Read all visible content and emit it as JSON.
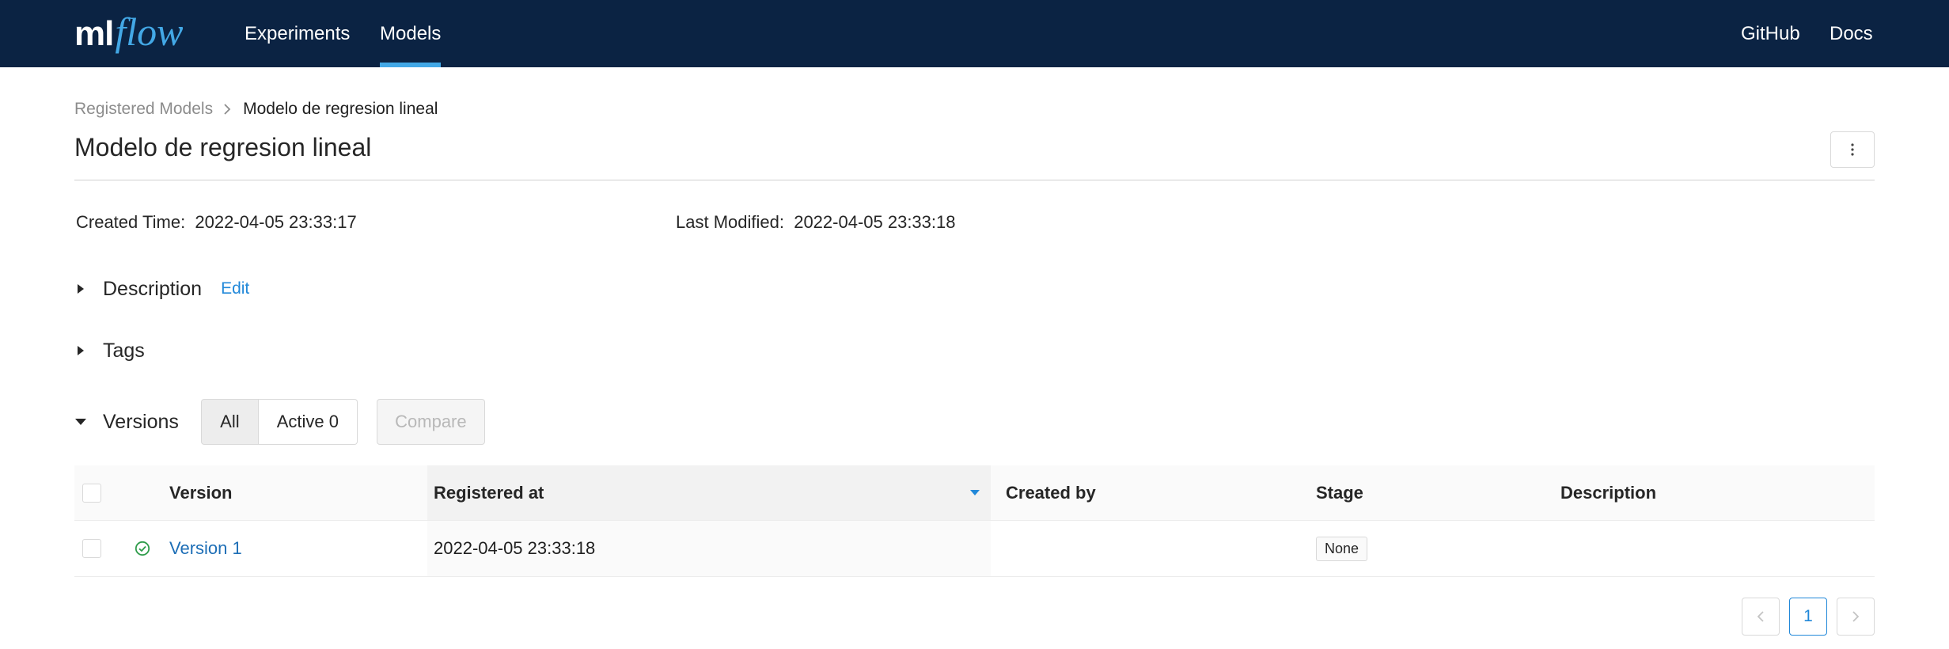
{
  "nav": {
    "logo_ml": "ml",
    "logo_flow": "flow",
    "experiments": "Experiments",
    "models": "Models",
    "github": "GitHub",
    "docs": "Docs",
    "active_tab": "Models",
    "accent_color": "#43a8e6",
    "background_color": "#0b2343"
  },
  "breadcrumb": {
    "parent": "Registered Models",
    "current": "Modelo de regresion lineal"
  },
  "page": {
    "title": "Modelo de regresion lineal",
    "created_label": "Created Time",
    "created_value": "2022-04-05 23:33:17",
    "modified_label": "Last Modified",
    "modified_value": "2022-04-05 23:33:18"
  },
  "sections": {
    "description": "Description",
    "edit": "Edit",
    "tags": "Tags",
    "versions": "Versions"
  },
  "filters": {
    "all": "All",
    "active": "Active 0",
    "compare": "Compare",
    "selected": "All"
  },
  "table": {
    "headers": [
      "Version",
      "Registered at",
      "Created by",
      "Stage",
      "Description"
    ],
    "sorted_column": "Registered at",
    "rows": [
      {
        "status_icon": "check-circle-icon",
        "version": "Version 1",
        "registered_at": "2022-04-05 23:33:18",
        "created_by": "",
        "stage": "None",
        "description": ""
      }
    ]
  },
  "pagination": {
    "current_page": "1"
  }
}
